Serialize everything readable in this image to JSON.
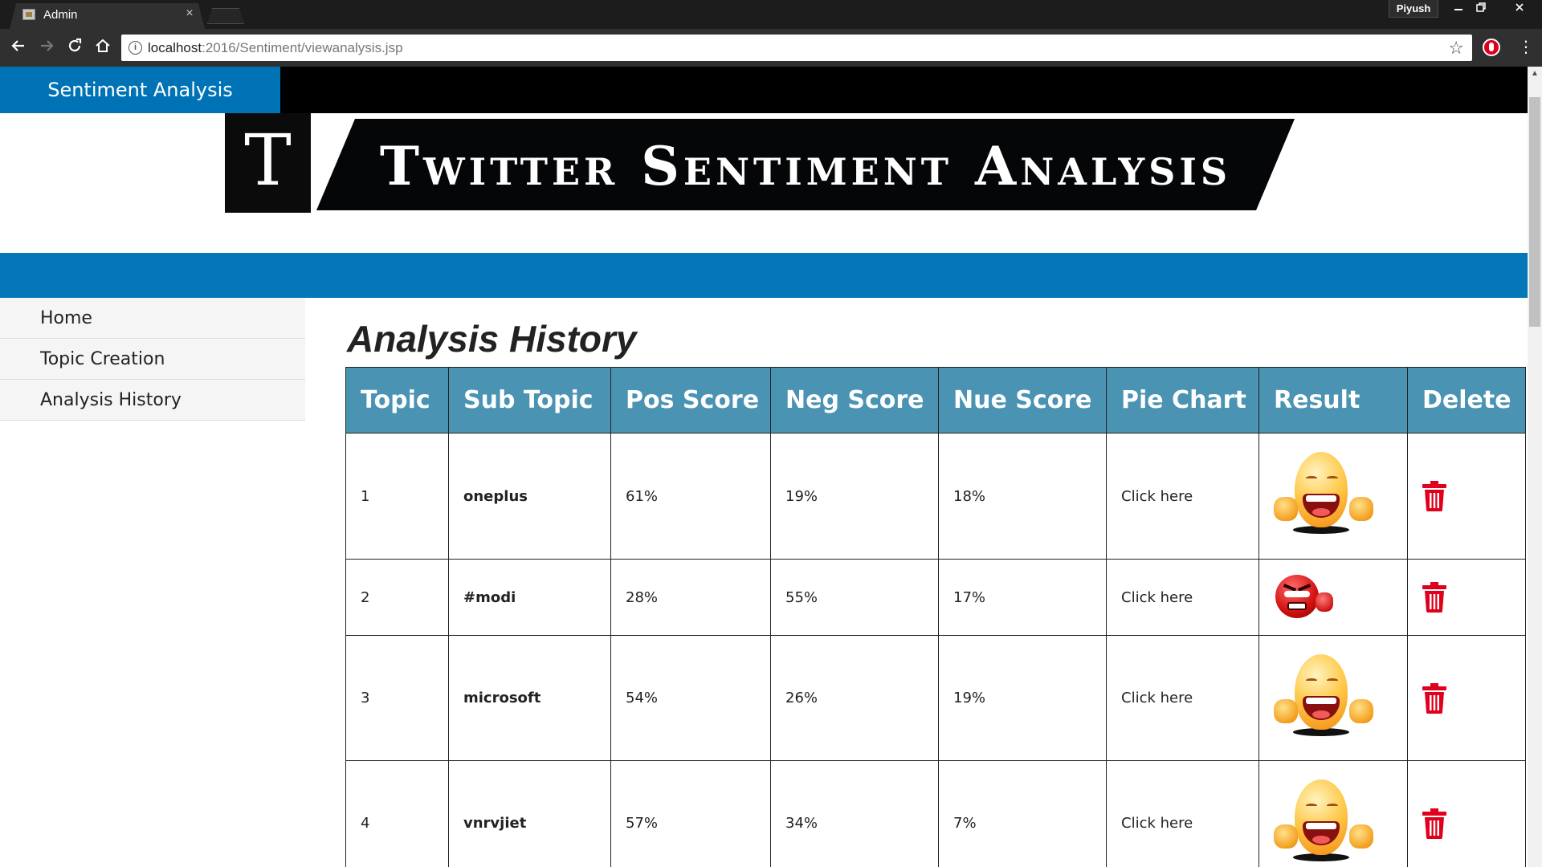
{
  "browser": {
    "tab_title": "Admin",
    "tab_close": "×",
    "profile_name": "Piyush",
    "url_host": "localhost",
    "url_path": ":2016/Sentiment/viewanalysis.jsp",
    "icons": {
      "back": "arrow-left-icon",
      "forward": "arrow-right-icon",
      "reload": "reload-icon",
      "home": "home-icon",
      "info": "info-icon",
      "bookmark": "star-icon",
      "extension": "extension-icon",
      "menu": "more-vertical-icon"
    }
  },
  "header": {
    "brand": "Sentiment Analysis",
    "banner_letter": "T",
    "banner_text": "Twitter Sentiment Analysis"
  },
  "sidebar": {
    "items": [
      {
        "label": "Home"
      },
      {
        "label": "Topic Creation"
      },
      {
        "label": "Analysis History"
      }
    ]
  },
  "main": {
    "title": "Analysis History",
    "columns": [
      "Topic",
      "Sub Topic",
      "Pos Score",
      "Neg Score",
      "Nue Score",
      "Pie Chart",
      "Result",
      "Delete"
    ],
    "rows": [
      {
        "topic": "1",
        "sub_topic": "oneplus",
        "pos": "61%",
        "neg": "19%",
        "nue": "18%",
        "pie_link": "Click here",
        "result_icon": "happy-emoji-icon"
      },
      {
        "topic": "2",
        "sub_topic": "#modi",
        "pos": "28%",
        "neg": "55%",
        "nue": "17%",
        "pie_link": "Click here",
        "result_icon": "angry-emoji-icon"
      },
      {
        "topic": "3",
        "sub_topic": "microsoft",
        "pos": "54%",
        "neg": "26%",
        "nue": "19%",
        "pie_link": "Click here",
        "result_icon": "happy-emoji-icon"
      },
      {
        "topic": "4",
        "sub_topic": "vnrvjiet",
        "pos": "57%",
        "neg": "34%",
        "nue": "7%",
        "pie_link": "Click here",
        "result_icon": "happy-emoji-icon"
      }
    ]
  },
  "colors": {
    "brand_blue": "#0073b7",
    "band_blue": "#0477b9",
    "table_header": "#4a93b3",
    "positive": "#1a9e3a",
    "negative": "#e0001b",
    "link": "#2a6fb5",
    "delete_icon": "#e0001b"
  }
}
